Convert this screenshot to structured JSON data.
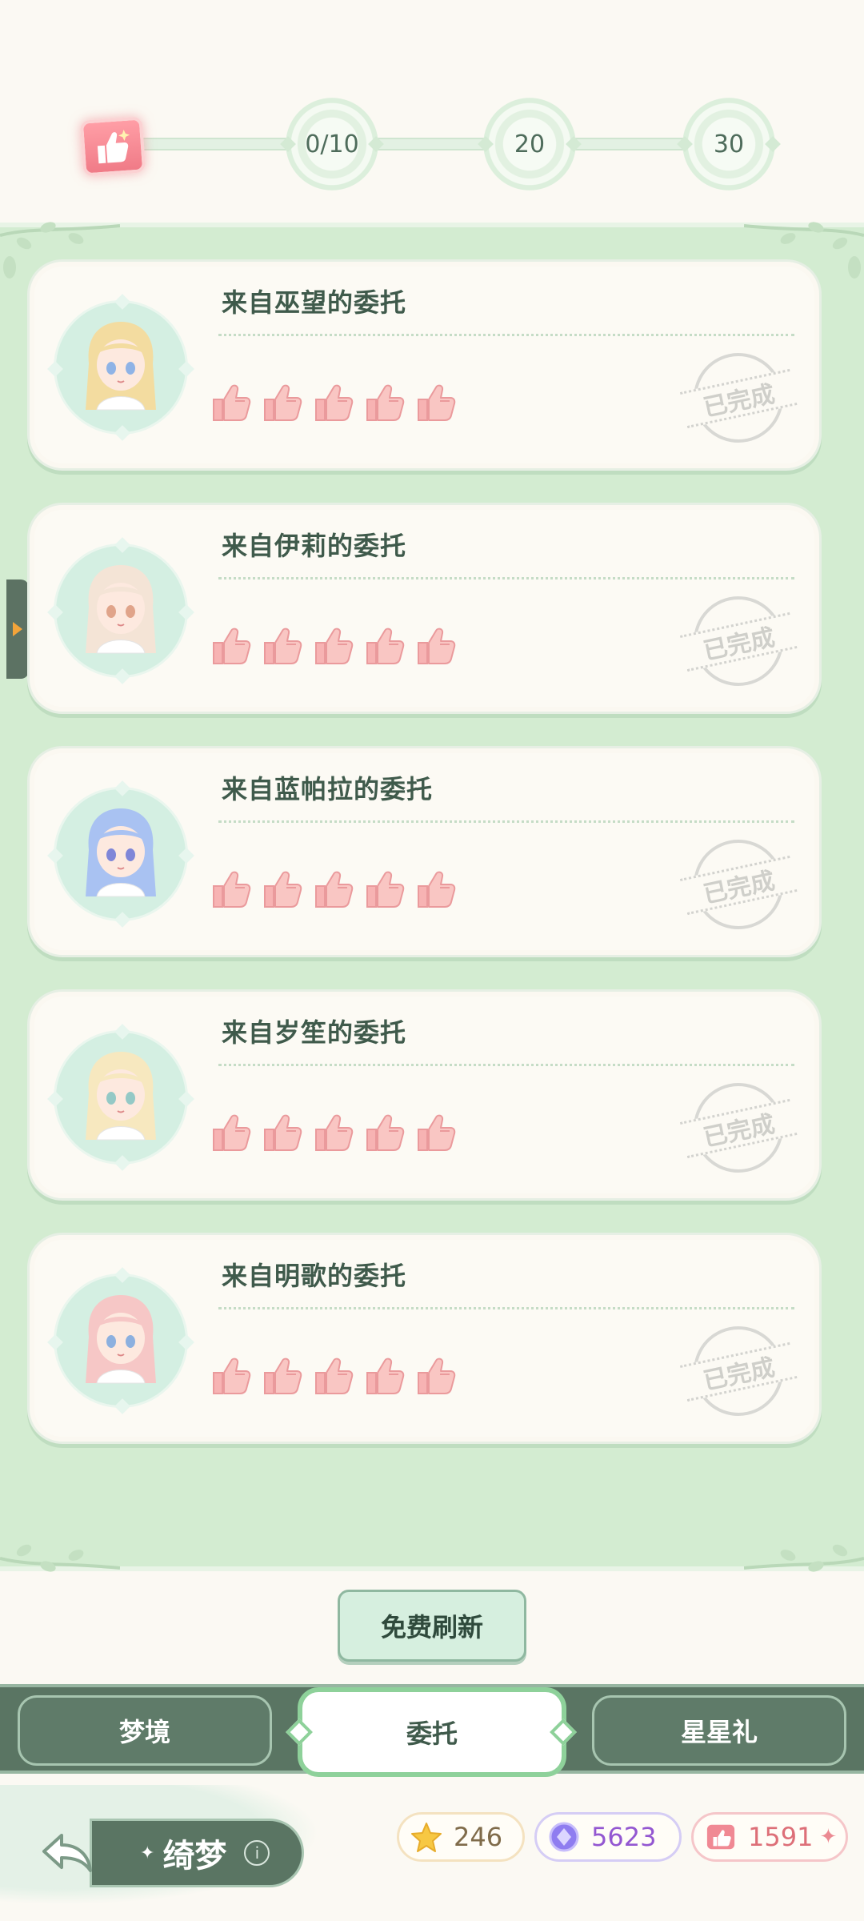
{
  "progress": {
    "milestones": [
      "0/10",
      "20",
      "30"
    ],
    "reward_icon": "thumbs-up-card-icon"
  },
  "commissions": [
    {
      "title": "来自巫望的委托",
      "likes": 5,
      "status": "已完成",
      "avatar_colors": {
        "hair": "#f3dca0",
        "eyes": "#8fb3e6"
      }
    },
    {
      "title": "来自伊莉的委托",
      "likes": 5,
      "status": "已完成",
      "avatar_colors": {
        "hair": "#f4e4d6",
        "eyes": "#e0a48a"
      }
    },
    {
      "title": "来自蓝帕拉的委托",
      "likes": 5,
      "status": "已完成",
      "avatar_colors": {
        "hair": "#a9c2f2",
        "eyes": "#7f86d8"
      }
    },
    {
      "title": "来自岁笙的委托",
      "likes": 5,
      "status": "已完成",
      "avatar_colors": {
        "hair": "#f7e8bf",
        "eyes": "#94c9c6"
      }
    },
    {
      "title": "来自明歌的委托",
      "likes": 5,
      "status": "已完成",
      "avatar_colors": {
        "hair": "#f6c7c6",
        "eyes": "#8cb0df"
      }
    }
  ],
  "refresh_button": "免费刷新",
  "tabs": [
    {
      "label": "梦境",
      "active": false
    },
    {
      "label": "委托",
      "active": true
    },
    {
      "label": "星星礼",
      "active": false
    }
  ],
  "player": {
    "name": "绮梦",
    "info_icon": "i"
  },
  "currencies": {
    "stars": "246",
    "gems": "5623",
    "likes": "1591"
  },
  "colors": {
    "panel_bg": "#d3ecd1",
    "accent_green": "#5a7563",
    "like_pink": "#f2a2a4"
  }
}
